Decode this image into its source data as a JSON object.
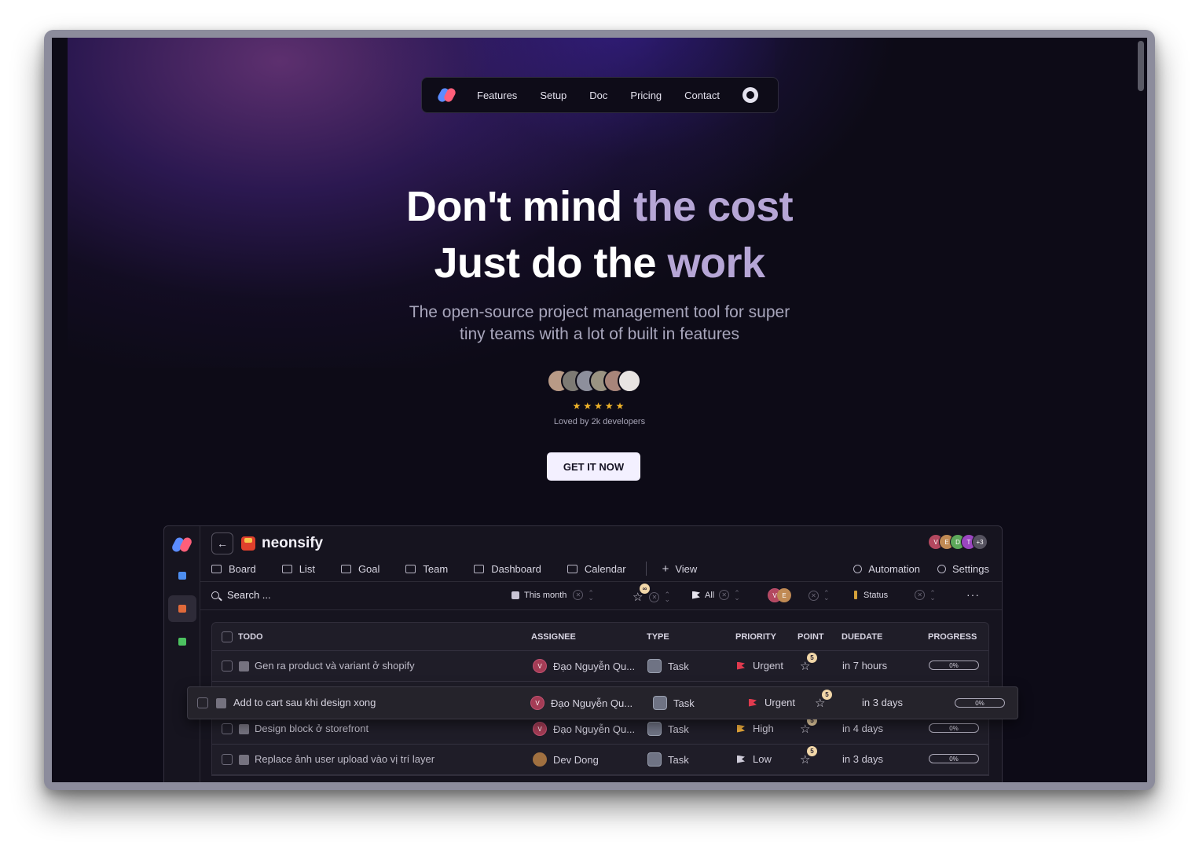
{
  "nav": {
    "links": [
      "Features",
      "Setup",
      "Doc",
      "Pricing",
      "Contact"
    ]
  },
  "hero": {
    "line1_white": "Don't mind ",
    "line1_purple": "the cost",
    "line2_white": "Just do the ",
    "line2_purple": "work",
    "subtitle_1": "The open-source project management tool for super",
    "subtitle_2": "tiny teams with a lot of built in features",
    "stars": "★★★★★",
    "loved": "Loved by 2k developers",
    "cta": "GET IT NOW"
  },
  "app": {
    "project_name": "neonsify",
    "back_icon": "←",
    "avatars": [
      "V",
      "E",
      "D",
      "T",
      "+3"
    ],
    "tabs": [
      "Board",
      "List",
      "Goal",
      "Team",
      "Dashboard",
      "Calendar"
    ],
    "view_label": "View",
    "automation_label": "Automation",
    "settings_label": "Settings",
    "filters": {
      "search": "Search ...",
      "date": "This month",
      "point_badge": "∞",
      "flag": "All",
      "assignees": [
        "V",
        "E"
      ],
      "status": "Status",
      "more": "···"
    },
    "columns": [
      "TODO",
      "ASSIGNEE",
      "TYPE",
      "PRIORITY",
      "POINT",
      "DUEDATE",
      "PROGRESS"
    ],
    "rows": [
      {
        "todo": "Gen ra product và variant ở shopify",
        "assignee": "Đạo Nguyễn Qu...",
        "assignee_initial": "V",
        "type": "Task",
        "priority": "Urgent",
        "priority_color": "#e03a4e",
        "point": "5",
        "due": "in 7 hours",
        "progress": "0%"
      },
      {
        "todo": "Design block ở storefront",
        "assignee": "Đạo Nguyễn Qu...",
        "assignee_initial": "V",
        "type": "Task",
        "priority": "High",
        "priority_color": "#e8a93a",
        "point": "5",
        "due": "in 4 days",
        "progress": "0%"
      },
      {
        "todo": "Replace ảnh user upload vào vị trí layer",
        "assignee": "Dev Dong",
        "assignee_initial": "",
        "type": "Task",
        "priority": "Low",
        "priority_color": "#cfccd9",
        "point": "5",
        "due": "in 3 days",
        "progress": "0%"
      }
    ],
    "drag_row": {
      "todo": "Add to cart sau khi design xong",
      "assignee": "Đạo Nguyễn Qu...",
      "assignee_initial": "V",
      "type": "Task",
      "priority": "Urgent",
      "priority_color": "#e03a4e",
      "point": "5",
      "due": "in 3 days",
      "progress": "0%"
    }
  },
  "colors": {
    "background": "#0d0b17",
    "accent_purple": "#b6a6d6",
    "urgent": "#e03a4e",
    "high": "#e8a93a"
  }
}
